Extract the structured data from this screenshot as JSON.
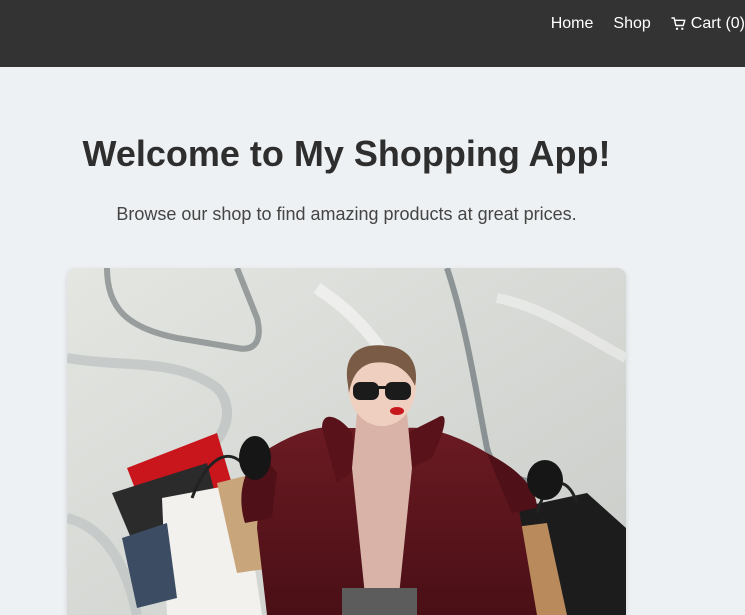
{
  "nav": {
    "links": [
      {
        "label": "Home"
      },
      {
        "label": "Shop"
      },
      {
        "label": "Cart (0)",
        "icon": "cart-icon"
      }
    ]
  },
  "hero": {
    "title": "Welcome to My Shopping App!",
    "subtitle": "Browse our shop to find amazing products at great prices.",
    "image": {
      "icon": "shopping-woman-photo"
    }
  },
  "colors": {
    "navbar": "#333333",
    "page_background": "#eef1f3",
    "title_text": "#2e2e2e",
    "subtitle_text": "#454545"
  }
}
